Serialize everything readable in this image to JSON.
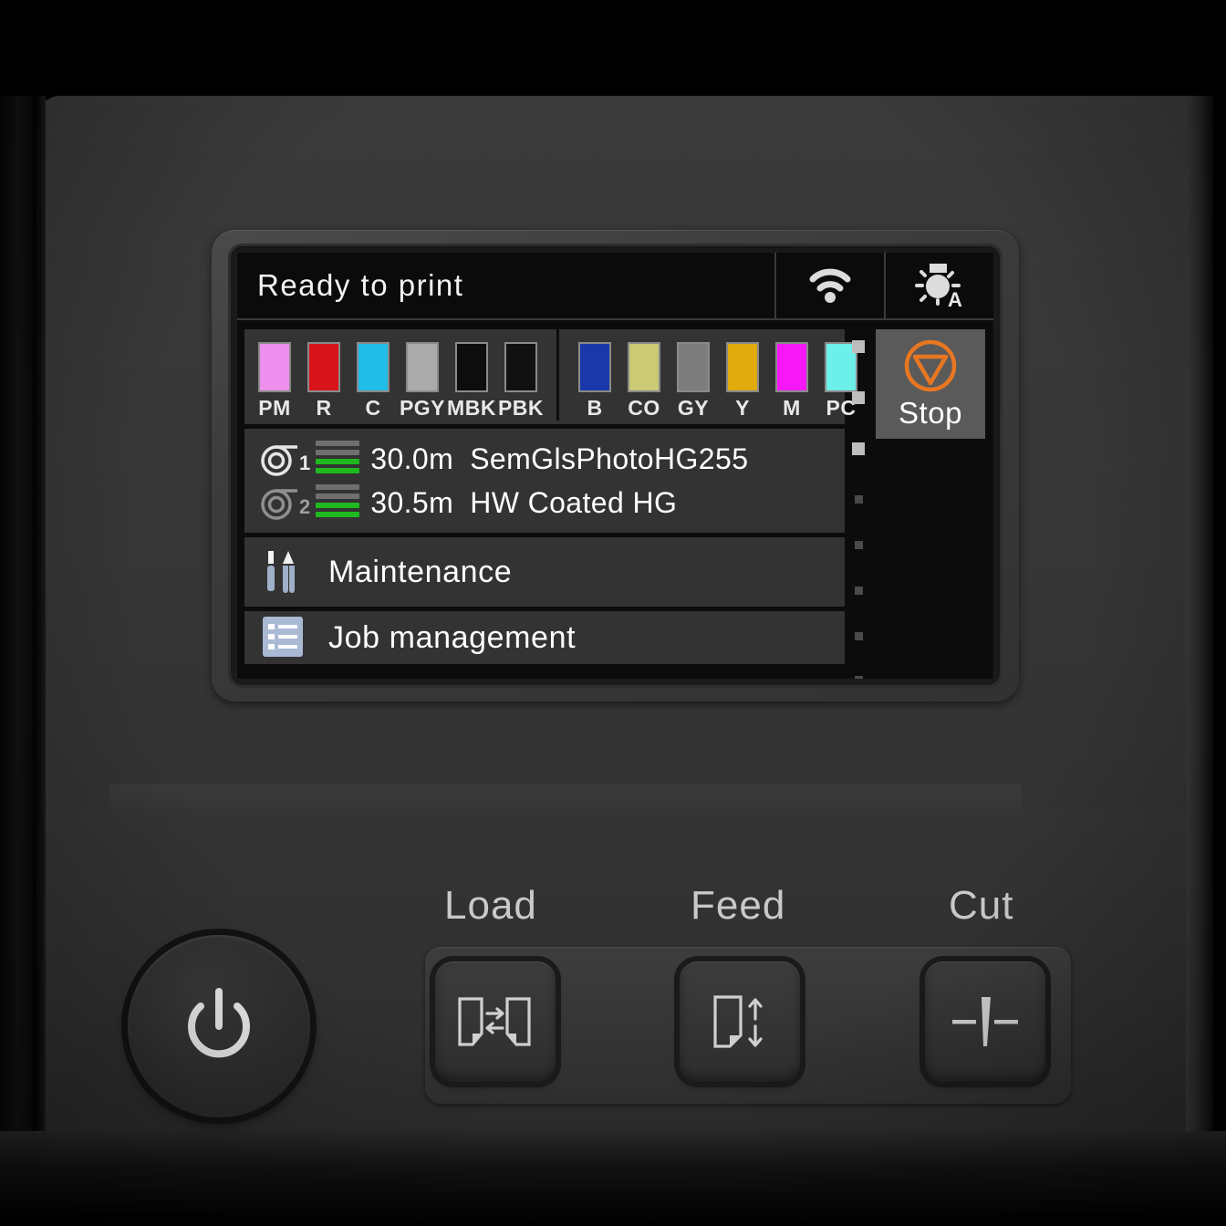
{
  "device": {
    "type": "large-format-printer-control-panel"
  },
  "screen": {
    "status_bar": {
      "message": "Ready to print",
      "icons": [
        {
          "name": "wifi-icon",
          "label": "wifi"
        },
        {
          "name": "lamp-auto-icon",
          "label": "A"
        }
      ]
    },
    "ink_panel": {
      "groups": [
        {
          "name": "ink-group-left",
          "inks": [
            {
              "code": "PM",
              "color": "#ee90ee"
            },
            {
              "code": "R",
              "color": "#d81319"
            },
            {
              "code": "C",
              "color": "#1fbde8"
            },
            {
              "code": "PGY",
              "color": "#ababab"
            },
            {
              "code": "MBK",
              "color": "#0d0d0d"
            },
            {
              "code": "PBK",
              "color": "#111111"
            }
          ]
        },
        {
          "name": "ink-group-right",
          "inks": [
            {
              "code": "B",
              "color": "#1b38aa"
            },
            {
              "code": "CO",
              "color": "#ccca74"
            },
            {
              "code": "GY",
              "color": "#7d7d7d"
            },
            {
              "code": "Y",
              "color": "#e0ab0d"
            },
            {
              "code": "M",
              "color": "#f618f6"
            },
            {
              "code": "PC",
              "color": "#6ef0ea"
            }
          ]
        }
      ]
    },
    "rolls": [
      {
        "roll_number": "1",
        "length": "30.0m",
        "media": "SemGlsPhotoHG255",
        "level_bars": [
          "off",
          "off",
          "on",
          "on"
        ],
        "active": true
      },
      {
        "roll_number": "2",
        "length": "30.5m",
        "media": "HW Coated HG",
        "level_bars": [
          "off",
          "off",
          "on",
          "on"
        ],
        "active": false
      }
    ],
    "menu_items": [
      {
        "label": "Maintenance",
        "icon": "tools-icon"
      },
      {
        "label": "Job management",
        "icon": "list-icon"
      }
    ],
    "stop_button": {
      "label": "Stop",
      "icon": "stop-triangle-icon",
      "accent_color": "#e87722"
    },
    "scroll_indicator": {
      "total": 8,
      "active": 3
    }
  },
  "hardware_buttons": {
    "power": {
      "name": "power-button",
      "icon": "power-icon"
    },
    "keys": [
      {
        "caption": "Load",
        "icon": "load-paper-icon"
      },
      {
        "caption": "Feed",
        "icon": "feed-paper-icon"
      },
      {
        "caption": "Cut",
        "icon": "cut-paper-icon"
      }
    ]
  },
  "colors": {
    "accent_orange": "#e87722",
    "level_green": "#1fb81f",
    "panel_gray": "#333333",
    "screen_black": "#0c0c0c"
  }
}
